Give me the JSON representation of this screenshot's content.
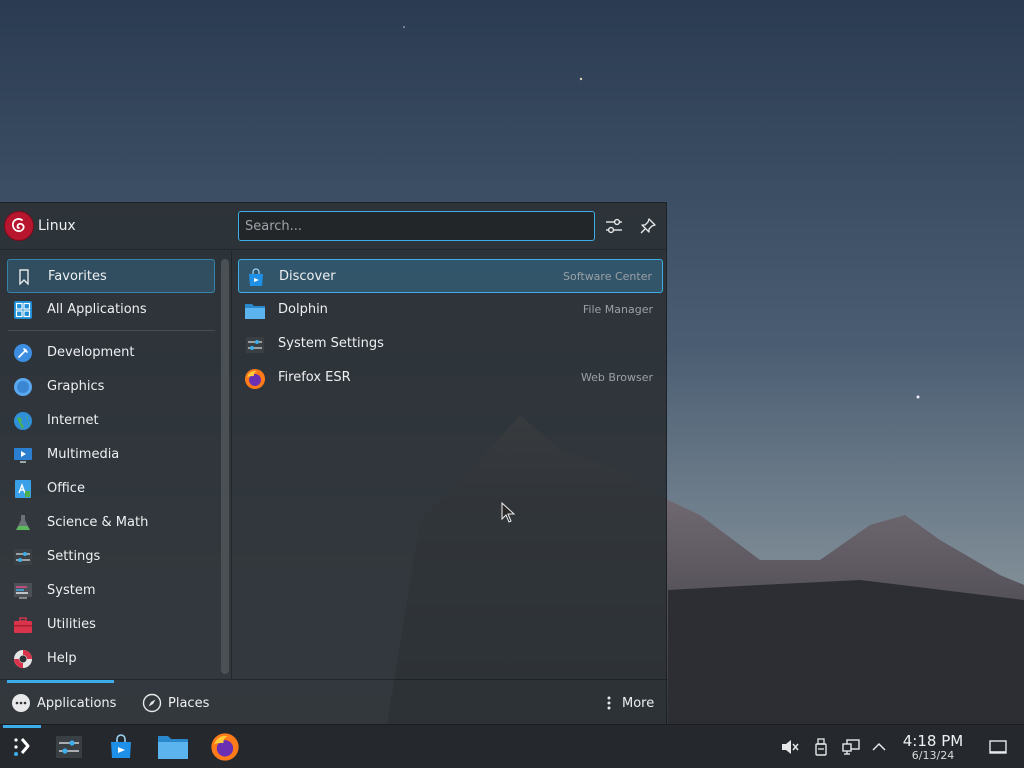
{
  "header": {
    "user_name": "Linux",
    "search_placeholder": "Search...",
    "filter_icon": "configure-icon",
    "pin_icon": "pin-icon"
  },
  "categories": [
    {
      "label": "Favorites",
      "icon": "bookmark-icon",
      "selected": true
    },
    {
      "label": "All Applications",
      "icon": "grid-icon"
    },
    {
      "label": "Development",
      "icon": "development-icon"
    },
    {
      "label": "Graphics",
      "icon": "graphics-icon"
    },
    {
      "label": "Internet",
      "icon": "globe-icon"
    },
    {
      "label": "Multimedia",
      "icon": "multimedia-icon"
    },
    {
      "label": "Office",
      "icon": "office-icon"
    },
    {
      "label": "Science & Math",
      "icon": "science-icon"
    },
    {
      "label": "Settings",
      "icon": "settings-icon"
    },
    {
      "label": "System",
      "icon": "system-icon"
    },
    {
      "label": "Utilities",
      "icon": "toolbox-icon"
    },
    {
      "label": "Help",
      "icon": "help-icon"
    }
  ],
  "favorites": [
    {
      "label": "Discover",
      "description": "Software Center",
      "icon": "discover-icon",
      "selected": true
    },
    {
      "label": "Dolphin",
      "description": "File Manager",
      "icon": "folder-icon"
    },
    {
      "label": "System Settings",
      "description": "",
      "icon": "system-settings-icon"
    },
    {
      "label": "Firefox ESR",
      "description": "Web Browser",
      "icon": "firefox-icon"
    }
  ],
  "footer": {
    "applications_label": "Applications",
    "places_label": "Places",
    "more_label": "More"
  },
  "taskbar": {
    "time": "4:18 PM",
    "date": "6/13/24",
    "accent": "#3daee9"
  }
}
